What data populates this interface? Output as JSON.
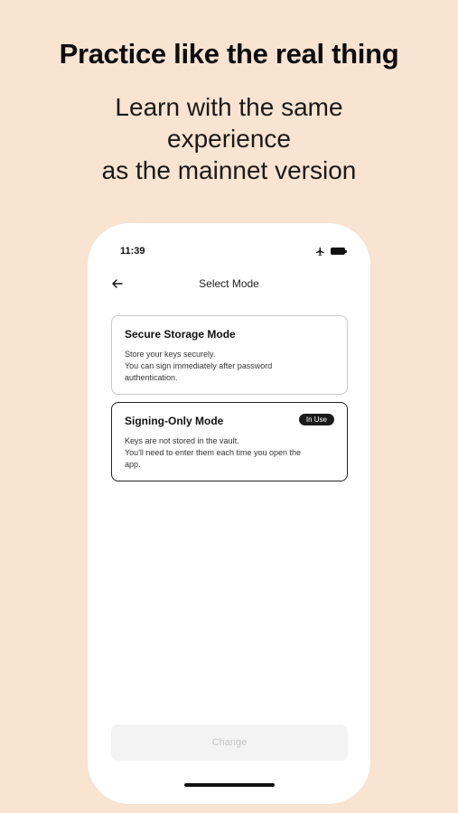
{
  "promo": {
    "headline": "Practice like the real thing",
    "sub_lines": [
      "Learn with the same",
      "experience",
      "as the mainnet version"
    ]
  },
  "status_bar": {
    "time": "11:39",
    "icons": [
      "airplane-icon",
      "battery-icon"
    ]
  },
  "nav": {
    "title": "Select Mode",
    "back_icon": "arrow-left-icon"
  },
  "modes": [
    {
      "title": "Secure Storage Mode",
      "description_lines": [
        "Store your keys securely.",
        "You can sign immediately after password",
        "authentication."
      ],
      "in_use": false
    },
    {
      "title": "Signing-Only Mode",
      "description_lines": [
        "Keys are not stored in the vault.",
        "You'll need to enter them each time you open the",
        "app."
      ],
      "in_use": true,
      "badge_label": "In Use"
    }
  ],
  "actions": {
    "change_label": "Change",
    "change_enabled": false
  },
  "colors": {
    "background": "#f9e4d2",
    "phone": "#ffffff",
    "accent_dark": "#1b1b1b",
    "disabled_button": "#f3f3f3",
    "disabled_text": "#c4c4c4"
  }
}
